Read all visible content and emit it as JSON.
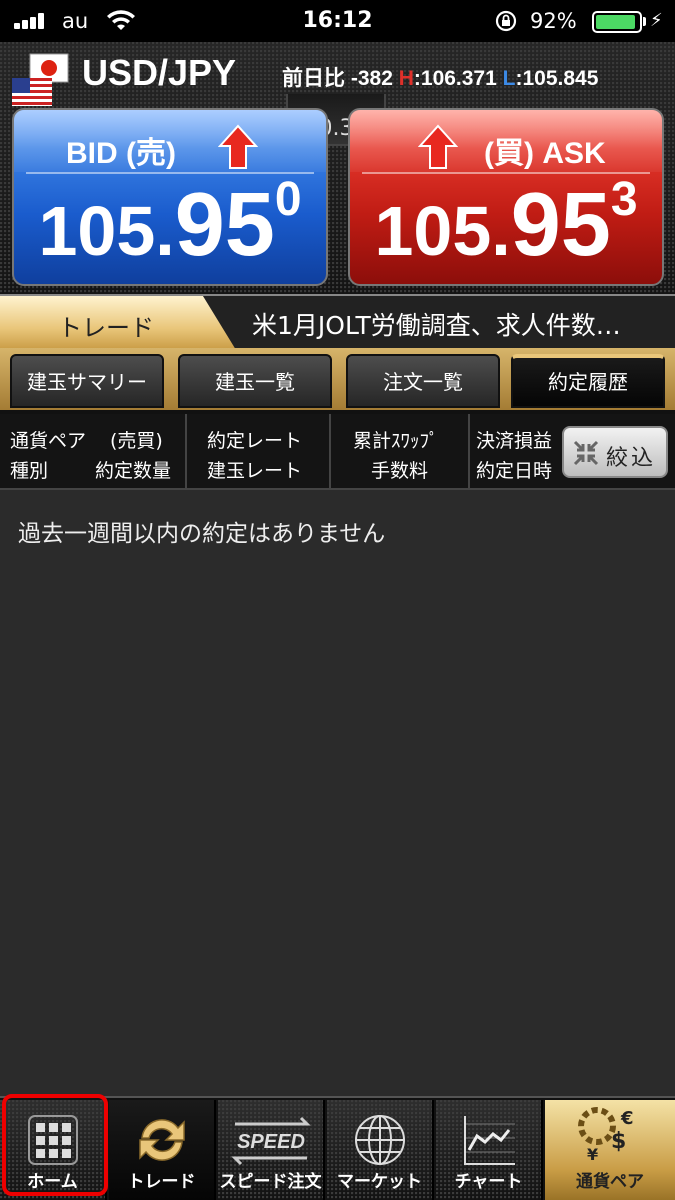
{
  "status_bar": {
    "carrier": "au",
    "time": "16:12",
    "battery_percent": "92%",
    "battery_level": 0.92,
    "icons": [
      "signal-icon",
      "wifi-icon",
      "rotation-lock-icon",
      "battery-icon",
      "charging-bolt-icon"
    ]
  },
  "header": {
    "pair": "USD/JPY",
    "flag_icon": "us-jp-flag-icon",
    "change_label": "前日比",
    "change_value": "-382",
    "high_label": "H",
    "high_value": ":106.371",
    "low_label": "L",
    "low_value": ":105.845",
    "spread": "0.3"
  },
  "bid": {
    "label": "BID (売)",
    "price_main": "105.",
    "price_big": "95",
    "price_sup": "0",
    "arrow_icon": "arrow-up-icon",
    "color": "#1a5ccd"
  },
  "ask": {
    "label": "(買) ASK",
    "price_main": "105.",
    "price_big": "95",
    "price_sup": "3",
    "arrow_icon": "arrow-up-icon",
    "color": "#c01c14"
  },
  "banner": {
    "tab_label": "トレード",
    "ticker": "米1月JOLT労働調査、求人件数…"
  },
  "tabs": [
    {
      "label": "建玉サマリー",
      "active": false
    },
    {
      "label": "建玉一覧",
      "active": false
    },
    {
      "label": "注文一覧",
      "active": false
    },
    {
      "label": "約定履歴",
      "active": true
    }
  ],
  "columns": {
    "c1_top_a": "通貨ペア",
    "c1_top_b": "(売買)",
    "c1_bot_a": "種別",
    "c1_bot_b": "約定数量",
    "c2_top": "約定レート",
    "c2_bot": "建玉レート",
    "c3_top": "累計ｽﾜｯﾌﾟ",
    "c3_bot": "手数料",
    "c4_top": "決済損益",
    "c4_bot": "約定日時",
    "filter_label": "絞込",
    "filter_icon": "collapse-arrows-icon"
  },
  "content": {
    "empty_message": "過去一週間以内の約定はありません"
  },
  "bottom_nav": [
    {
      "label": "ホーム",
      "icon": "grid-icon",
      "highlighted": true
    },
    {
      "label": "トレード",
      "icon": "exchange-arrows-icon",
      "active": true
    },
    {
      "label": "スピード注文",
      "icon": "speed-icon",
      "icon_text": "SPEED"
    },
    {
      "label": "マーケット",
      "icon": "globe-icon"
    },
    {
      "label": "チャート",
      "icon": "line-chart-icon"
    },
    {
      "label": "通貨ペア",
      "icon": "currency-gear-icon"
    }
  ],
  "colors": {
    "accent_gold": "#e9c67a",
    "high_red": "#e0302a",
    "low_blue": "#3c8ae6",
    "highlight_red": "#ee0000"
  }
}
